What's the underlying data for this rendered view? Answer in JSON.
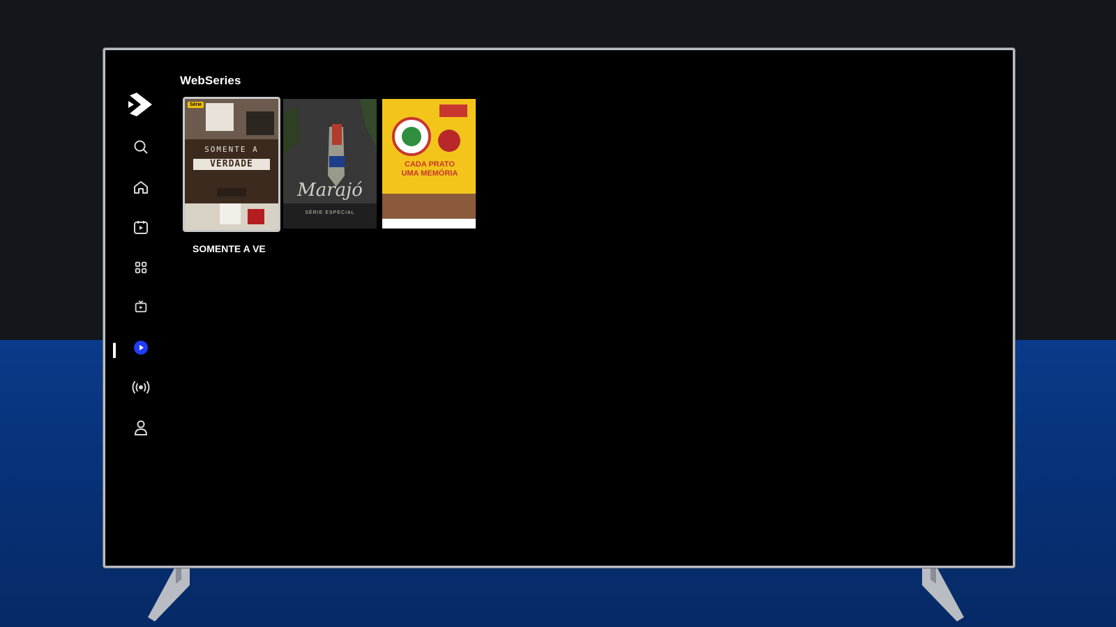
{
  "app": {
    "section_title": "WebSeries"
  },
  "sidebar": {
    "items": [
      {
        "name": "search",
        "icon": "search-icon"
      },
      {
        "name": "home",
        "icon": "home-icon"
      },
      {
        "name": "movies",
        "icon": "calendar-play-icon"
      },
      {
        "name": "categories",
        "icon": "grid-icon"
      },
      {
        "name": "tv",
        "icon": "tv-icon"
      },
      {
        "name": "webseries",
        "icon": "play-circle-icon",
        "active": true
      },
      {
        "name": "live",
        "icon": "broadcast-icon"
      },
      {
        "name": "profile",
        "icon": "user-icon"
      }
    ]
  },
  "row": {
    "items": [
      {
        "title": "SOMENTE A VE",
        "badge": "Série",
        "poster_text_top": "SOMENTE A",
        "poster_text_main": "VERDADE",
        "focused": true
      },
      {
        "title": "",
        "poster_text_main": "Marajó",
        "poster_text_sub": "SÉRIE ESPECIAL",
        "focused": false
      },
      {
        "title": "",
        "poster_text_main": "CADA PRATO UMA MEMÓRIA",
        "focused": false
      }
    ]
  },
  "colors": {
    "screen_bg": "#000000",
    "accent_blue": "#1f3cff",
    "page_dark": "#13161b",
    "page_blue": "#0a3a8a"
  }
}
